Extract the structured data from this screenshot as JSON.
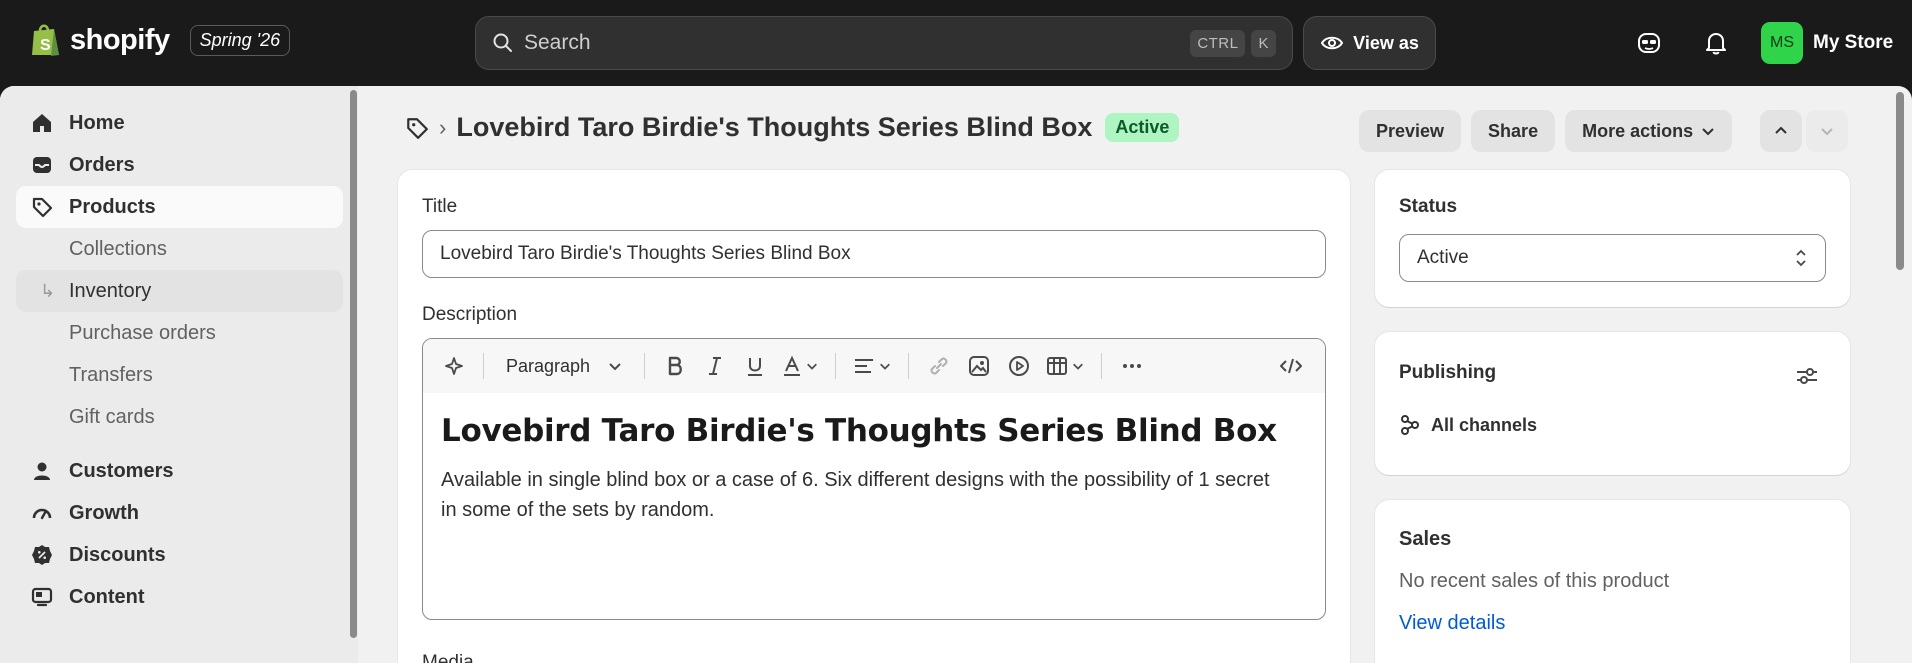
{
  "topbar": {
    "brand": "shopify",
    "season": "Spring '26",
    "search_placeholder": "Search",
    "shortcut_ctrl": "CTRL",
    "shortcut_key": "K",
    "view_as": "View as",
    "avatar_initials": "MS",
    "store_name": "My Store"
  },
  "sidebar": {
    "items": [
      {
        "label": "Home",
        "icon": "home-icon"
      },
      {
        "label": "Orders",
        "icon": "inbox-icon"
      },
      {
        "label": "Products",
        "icon": "tag-icon"
      },
      {
        "label": "Collections"
      },
      {
        "label": "Inventory"
      },
      {
        "label": "Purchase orders"
      },
      {
        "label": "Transfers"
      },
      {
        "label": "Gift cards"
      },
      {
        "label": "Customers",
        "icon": "person-icon"
      },
      {
        "label": "Growth",
        "icon": "gauge-icon"
      },
      {
        "label": "Discounts",
        "icon": "discount-icon"
      },
      {
        "label": "Content",
        "icon": "monitor-icon"
      }
    ]
  },
  "header": {
    "title": "Lovebird Taro Birdie's Thoughts Series Blind Box",
    "status_badge": "Active",
    "preview": "Preview",
    "share": "Share",
    "more_actions": "More actions"
  },
  "product": {
    "title_label": "Title",
    "title_value": "Lovebird Taro Birdie's Thoughts Series Blind Box",
    "description_label": "Description",
    "format": "Paragraph",
    "description_heading": "Lovebird Taro Birdie's Thoughts Series Blind Box",
    "description_body": "Available in single blind box or a case of 6. Six different designs with the possibility of 1 secret in some of the sets by random.",
    "media_label": "Media"
  },
  "status_card": {
    "label": "Status",
    "value": "Active"
  },
  "publishing_card": {
    "label": "Publishing",
    "channels": "All channels"
  },
  "sales_card": {
    "label": "Sales",
    "text": "No recent sales of this product",
    "link": "View details"
  },
  "colors": {
    "accent_green": "#30d44b",
    "badge_bg": "#aff5c1",
    "link": "#005bd3",
    "topbar": "#1a1a1a"
  }
}
